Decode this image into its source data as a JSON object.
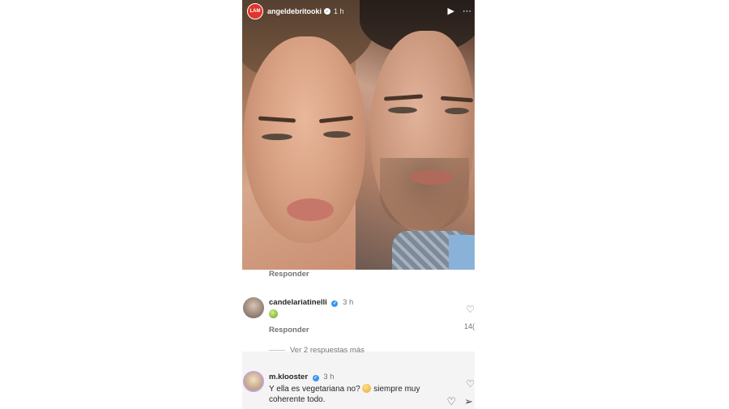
{
  "story": {
    "account_logo_text": "LAM",
    "username": "angeldebritooki",
    "time": "1 h",
    "play_icon": "play-icon",
    "more_icon": "more-options-icon"
  },
  "comments": {
    "reply_label_top": "Responder",
    "first": {
      "username": "candelariatinelli",
      "time": "3 h",
      "text_emoji": "pear-emoji",
      "reply_label": "Responder",
      "like_count": "14("
    },
    "more_replies": "Ver 2 respuestas más",
    "second": {
      "username": "m.klooster",
      "time": "3 h",
      "text_line1_a": "Y ella es vegetariana no?",
      "text_line1_b": "siempre muy",
      "text_line2": "coherente todo."
    }
  },
  "colors": {
    "accent_red": "#e1342b",
    "verified_blue": "#3897f0",
    "muted_text": "#737373"
  }
}
